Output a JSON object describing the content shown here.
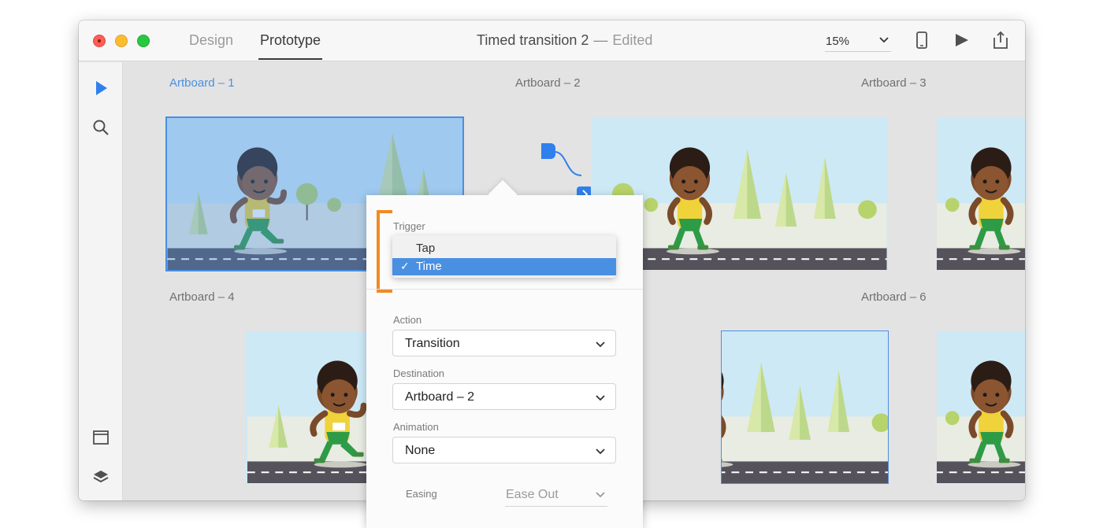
{
  "window": {
    "tabs": [
      {
        "label": "Design"
      },
      {
        "label": "Prototype"
      }
    ],
    "title": "Timed transition 2",
    "separator": "—",
    "status": "Edited",
    "zoom": "15%"
  },
  "toolbar_icons": [
    "device-preview-icon",
    "play-icon",
    "share-icon"
  ],
  "tools": [
    "select-arrow-icon",
    "zoom-search-icon",
    "artboard-icon",
    "layers-icon"
  ],
  "artboards": [
    {
      "label": "Artboard – 1"
    },
    {
      "label": "Artboard – 2"
    },
    {
      "label": "Artboard – 3"
    },
    {
      "label": "Artboard – 4"
    },
    {
      "label": "Artboard – 6"
    }
  ],
  "popover": {
    "trigger_label": "Trigger",
    "trigger_options": [
      "Tap",
      "Time"
    ],
    "trigger_selected": "Time",
    "check": "✓",
    "action_label": "Action",
    "action_value": "Transition",
    "destination_label": "Destination",
    "destination_value": "Artboard – 2",
    "animation_label": "Animation",
    "animation_value": "None",
    "easing_label": "Easing",
    "easing_value": "Ease Out"
  },
  "colors": {
    "accent": "#4a90e2",
    "bracket": "#f08a24",
    "traffic_red": "#fc5f57",
    "traffic_yellow": "#fdbc2e",
    "traffic_green": "#28c840"
  }
}
